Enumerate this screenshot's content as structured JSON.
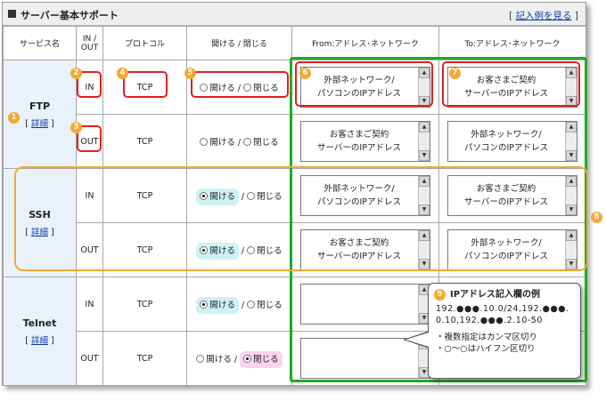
{
  "header": {
    "title": "サーバー基本サポート",
    "help_prefix": "[ ",
    "help_link": "記入例を見る",
    "help_suffix": " ]"
  },
  "columns": {
    "service": "サービス名",
    "inout": "IN / OUT",
    "protocol": "プロトコル",
    "openclose": "開ける / 閉じる",
    "from": "From:アドレス･ネットワーク",
    "to": "To:アドレス･ネットワーク"
  },
  "labels": {
    "open": "開ける",
    "slash": " / ",
    "close": "閉じる",
    "detail_prefix": "[ ",
    "detail_link": "詳細",
    "detail_suffix": " ]"
  },
  "services": [
    {
      "name": "FTP"
    },
    {
      "name": "SSH"
    },
    {
      "name": "Telnet"
    }
  ],
  "rows": [
    {
      "direction": "IN",
      "protocol": "TCP",
      "selected": "none",
      "from_l1": "外部ネットワーク/",
      "from_l2": "パソコンのIPアドレス",
      "to_l1": "お客さまご契約",
      "to_l2": "サーバーのIPアドレス"
    },
    {
      "direction": "OUT",
      "protocol": "TCP",
      "selected": "none",
      "from_l1": "お客さまご契約",
      "from_l2": "サーバーのIPアドレス",
      "to_l1": "外部ネットワーク/",
      "to_l2": "パソコンのIPアドレス"
    },
    {
      "direction": "IN",
      "protocol": "TCP",
      "selected": "open",
      "from_l1": "外部ネットワーク/",
      "from_l2": "パソコンのIPアドレス",
      "to_l1": "お客さまご契約",
      "to_l2": "サーバーのIPアドレス"
    },
    {
      "direction": "OUT",
      "protocol": "TCP",
      "selected": "open",
      "from_l1": "お客さまご契約",
      "from_l2": "サーバーのIPアドレス",
      "to_l1": "外部ネットワーク/",
      "to_l2": "パソコンのIPアドレス"
    },
    {
      "direction": "IN",
      "protocol": "TCP",
      "selected": "open",
      "from_l1": "",
      "from_l2": "",
      "to_l1": "",
      "to_l2": ""
    },
    {
      "direction": "OUT",
      "protocol": "TCP",
      "selected": "close",
      "from_l1": "",
      "from_l2": "",
      "to_l1": "",
      "to_l2": ""
    }
  ],
  "callout": {
    "title": "IPアドレス記入欄の例",
    "example": "192.●●●.10.0/24,192.●●●.0.10,192.●●●.2.10-50",
    "note1": "・複数指定はカンマ区切り",
    "note2": "・○～○はハイフン区切り"
  },
  "markers": [
    "1",
    "2",
    "3",
    "4",
    "5",
    "6",
    "7",
    "8",
    "9"
  ],
  "colors": {
    "marker": "#f6a832",
    "red_highlight": "#e02020",
    "green_highlight": "#22aa22",
    "service_cell": "#e9f2fa",
    "open_highlight": "#cdf2f6",
    "close_highlight": "#fcd2ec",
    "link": "#0a3ca8"
  },
  "icons": [
    "scroll-up-arrow-icon",
    "scroll-down-arrow-icon",
    "radio-button-icon"
  ]
}
